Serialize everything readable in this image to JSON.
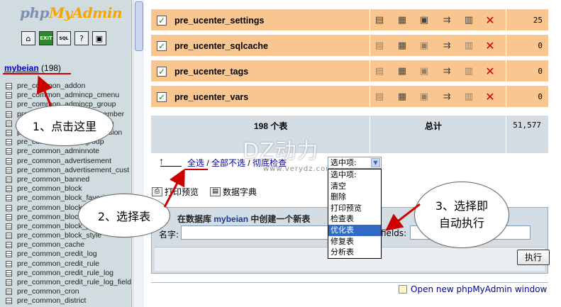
{
  "app": {
    "logo_prefix": "php",
    "logo_main": "MyAdmin"
  },
  "nav": {
    "icons": [
      "home-icon",
      "query-icon",
      "sql-icon",
      "docs-icon",
      "sql-window-icon"
    ],
    "database": {
      "name": "mybeian",
      "count": "(198)"
    },
    "tables": [
      "pre_common_addon",
      "pre_common_admincp_cmenu",
      "pre_common_admincp_group",
      "pre_common_admincp_member",
      "pre_common_admincp_perm",
      "pre_common_admincp_session",
      "pre_common_admingroup",
      "pre_common_adminnote",
      "pre_common_advertisement",
      "pre_common_advertisement_cust",
      "pre_common_banned",
      "pre_common_block",
      "pre_common_block_favorite",
      "pre_common_block_item",
      "pre_common_block_permission",
      "pre_common_block_pic",
      "pre_common_block_style",
      "pre_common_cache",
      "pre_common_credit_log",
      "pre_common_credit_rule",
      "pre_common_credit_rule_log",
      "pre_common_credit_rule_log_field",
      "pre_common_cron",
      "pre_common_district"
    ]
  },
  "tables_view": {
    "rows": [
      {
        "name": "pre_ucenter_settings",
        "checked": true,
        "count": "25"
      },
      {
        "name": "pre_ucenter_sqlcache",
        "checked": true,
        "count": "0"
      },
      {
        "name": "pre_ucenter_tags",
        "checked": true,
        "count": "0"
      },
      {
        "name": "pre_ucenter_vars",
        "checked": true,
        "count": "0"
      }
    ],
    "summary": {
      "tables": "198 个表",
      "total_label": "总计",
      "total": "51,577"
    }
  },
  "selection": {
    "check_all": "全选",
    "uncheck_all": "全部不选",
    "check_overhead": "彻底检查",
    "sep": " / ",
    "select_value": "选中项:",
    "options": [
      "选中项:",
      "清空",
      "删除",
      "打印预览",
      "检查表",
      "优化表",
      "修复表",
      "分析表"
    ],
    "selected_option": "优化表"
  },
  "links": {
    "print_view": "打印预览",
    "data_dictionary": "数据字典"
  },
  "create_table": {
    "prefix": "在数据库 ",
    "db": "mybeian",
    "suffix": " 中创建一个新表",
    "name_label": "名字:",
    "fields_label": "fields:",
    "go": "执行"
  },
  "footer": {
    "open_window": "Open new phpMyAdmin window"
  },
  "watermark": {
    "main": "DZ动力",
    "sub": "www.verydz.com"
  },
  "annotations": {
    "step1": "1、点击这里",
    "step2": "2、选择表",
    "step3_line1": "3、选择即",
    "step3_line2": "自动执行"
  },
  "colors": {
    "row_bg": "#fac690",
    "summary_bg": "#d5dde4",
    "nav_bg": "#d0dce0",
    "annotation_red": "#cc0000"
  }
}
